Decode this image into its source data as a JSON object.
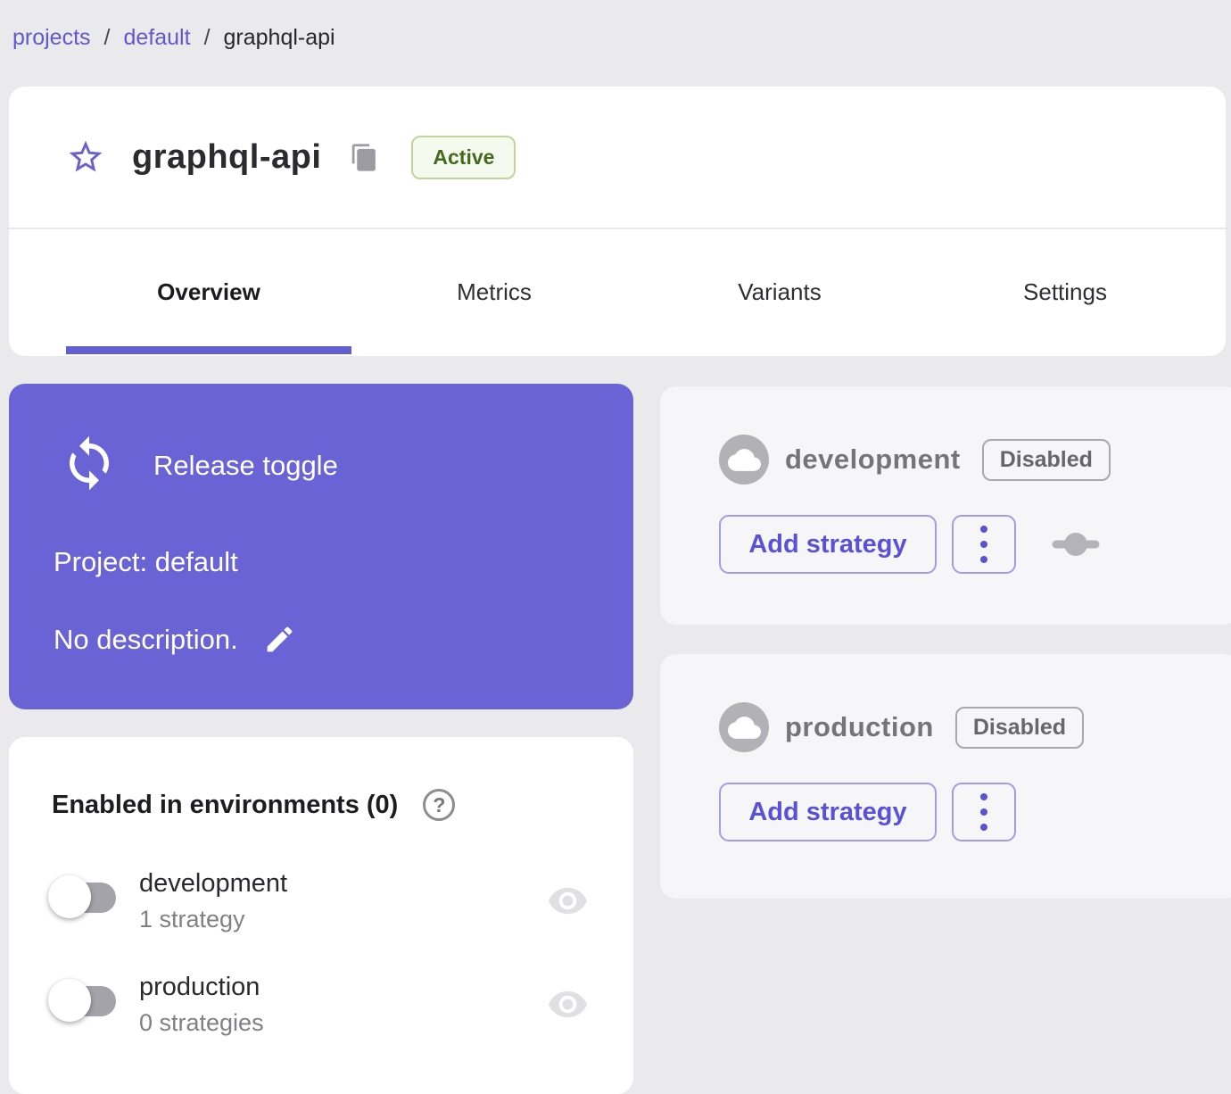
{
  "colors": {
    "page_background": "#eaeaec",
    "card_background": "#ffffff",
    "env_card_background": "#f6f6f8",
    "accent_purple": "#6a63d6",
    "link_purple": "#6159c9",
    "button_purple": "#5b51d7",
    "active_badge_text": "#44691f",
    "active_badge_background": "#f5faef",
    "active_badge_border": "#bcd69c",
    "muted_gray": "#757579"
  },
  "icons": {
    "favorite": "star-icon",
    "copy": "copy-icon",
    "toggle_type": "loop-icon",
    "edit": "pencil-icon",
    "environment": "cloud-icon",
    "menu": "kebab-icon",
    "strategy_slider": "commit-icon",
    "help": "question-mark-icon",
    "visibility": "eye-icon"
  },
  "breadcrumb": {
    "separator": "/",
    "items": [
      "projects",
      "default",
      "graphql-api"
    ]
  },
  "header": {
    "title": "graphql-api",
    "status_badge": "Active",
    "tabs": [
      {
        "label": "Overview",
        "active": true
      },
      {
        "label": "Metrics",
        "active": false
      },
      {
        "label": "Variants",
        "active": false
      },
      {
        "label": "Settings",
        "active": false
      }
    ]
  },
  "info_card": {
    "type_label": "Release toggle",
    "project_label": "Project: default",
    "description_label": "No description."
  },
  "environments": [
    {
      "name": "development",
      "status": "Disabled",
      "add_button": "Add strategy"
    },
    {
      "name": "production",
      "status": "Disabled",
      "add_button": "Add strategy"
    }
  ],
  "enabled_panel": {
    "title": "Enabled in environments (0)",
    "help_glyph": "?",
    "rows": [
      {
        "name": "development",
        "strategies": "1 strategy",
        "enabled": false
      },
      {
        "name": "production",
        "strategies": "0 strategies",
        "enabled": false
      }
    ]
  }
}
